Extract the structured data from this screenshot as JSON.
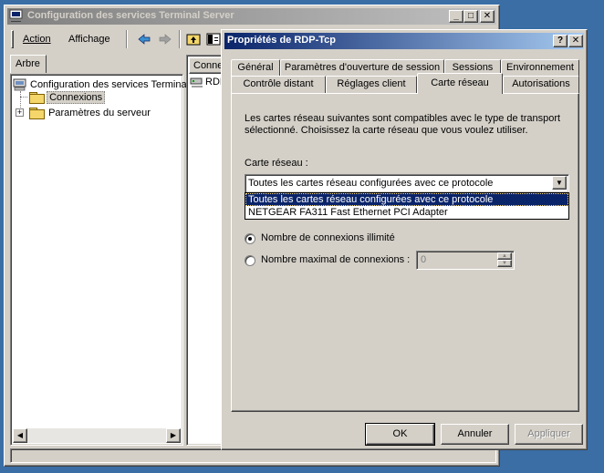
{
  "main_window": {
    "title": "Configuration des services Terminal Server",
    "menu": {
      "action": "Action",
      "view": "Affichage"
    },
    "left_tab": "Arbre",
    "tree": {
      "root": "Configuration des services Termina",
      "connections": "Connexions",
      "server_settings": "Paramètres du serveur"
    },
    "right_header": "Connex",
    "right_item": "RDP"
  },
  "dialog": {
    "title": "Propriétés de RDP-Tcp",
    "tabs_back": [
      "Général",
      "Paramètres d'ouverture de session",
      "Sessions",
      "Environnement"
    ],
    "tabs_front": [
      "Contrôle distant",
      "Réglages client",
      "Carte réseau",
      "Autorisations"
    ],
    "active_tab": "Carte réseau",
    "description": "Les cartes réseau suivantes sont compatibles avec le type de transport sélectionné. Choisissez la carte réseau que vous voulez utiliser.",
    "adapter_label": "Carte réseau :",
    "adapter_selected": "Toutes les cartes réseau configurées avec ce protocole",
    "adapter_options": [
      "Toutes les cartes réseau configurées avec ce protocole",
      "NETGEAR FA311 Fast Ethernet PCI Adapter"
    ],
    "radio_unlimited": "Nombre de connexions illimité",
    "radio_max": "Nombre maximal de connexions :",
    "max_value": "0",
    "buttons": {
      "ok": "OK",
      "cancel": "Annuler",
      "apply": "Appliquer"
    }
  },
  "colors": {
    "desktop": "#3a6ea5",
    "active_title": "#0a246a",
    "highlight": "#0a246a",
    "face": "#d4d0c8"
  }
}
